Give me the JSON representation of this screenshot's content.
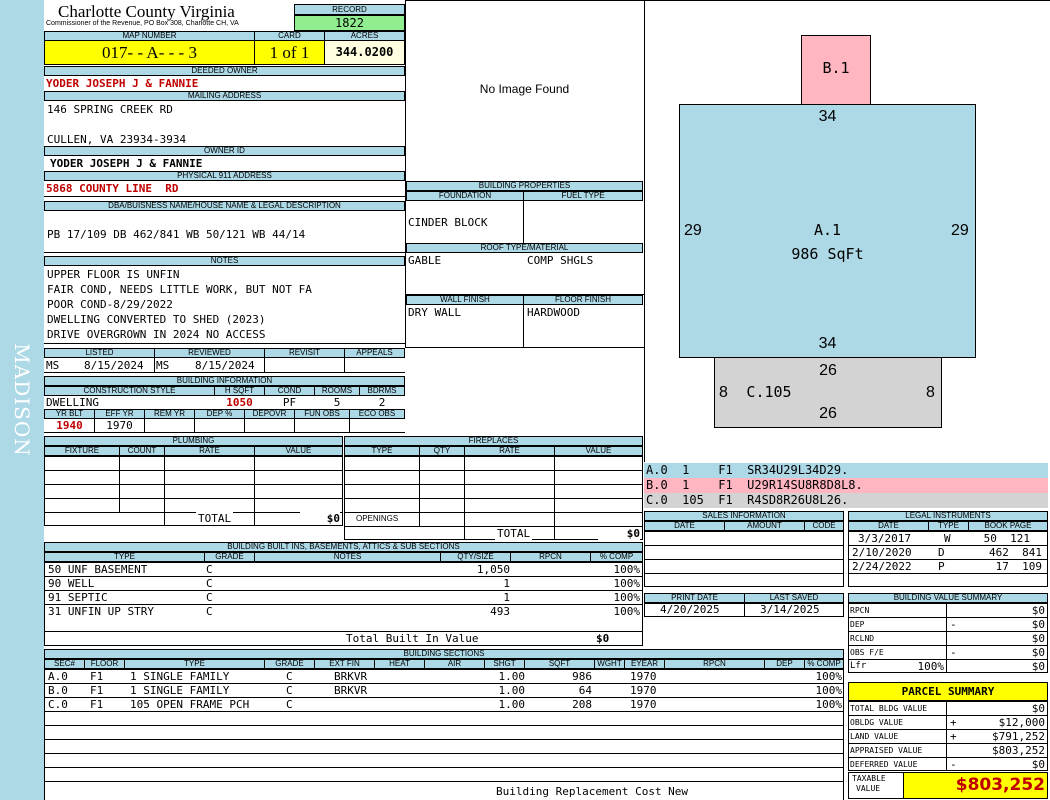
{
  "side_label": "MADISON",
  "header": {
    "title": "Charlotte County Virginia",
    "subtitle": "Commissioner of the Revenue, PO Box 308, Charlotte CH, VA",
    "record_label": "RECORD",
    "record": "1822",
    "map_label": "MAP NUMBER",
    "map": "017- - A- - - 3",
    "card_label": "CARD",
    "card": "1 of 1",
    "acres_label": "ACRES",
    "acres": "344.0200"
  },
  "owner": {
    "deeded_label": "DEEDED OWNER",
    "deeded": "YODER JOSEPH J & FANNIE",
    "mailing_label": "MAILING ADDRESS",
    "address1": "146 SPRING CREEK RD",
    "address2": "CULLEN, VA 23934-3934",
    "owner_id_label": "OWNER ID",
    "owner_id": "YODER JOSEPH J & FANNIE",
    "physical_label": "PHYSICAL 911 ADDRESS",
    "physical": "5868 COUNTY LINE  RD"
  },
  "dba": {
    "label": "DBA/BUISNESS NAME/HOUSE NAME & LEGAL DESCRIPTION",
    "text": "PB 17/109 DB 462/841 WB 50/121 WB 44/14"
  },
  "notes": {
    "label": "NOTES",
    "lines": [
      "UPPER FLOOR IS UNFIN",
      "FAIR COND, NEEDS LITTLE WORK, BUT NOT FA",
      "POOR COND-8/29/2022",
      "DWELLING CONVERTED TO SHED (2023)",
      "DRIVE OVERGROWN IN 2024 NO ACCESS"
    ]
  },
  "review": {
    "listed_label": "LISTED",
    "listed_by": "MS",
    "listed": "8/15/2024",
    "reviewed_label": "REVIEWED",
    "reviewed_by": "MS",
    "reviewed": "8/15/2024",
    "revisit_label": "REVISIT",
    "appeals_label": "APPEALS"
  },
  "building_info": {
    "label": "BUILDING INFORMATION",
    "style_label": "CONSTRUCTION STYLE",
    "style": "DWELLING",
    "hsqft_label": "H SQFT",
    "hsqft": "1050",
    "cond_label": "COND",
    "cond": "PF",
    "rooms_label": "ROOMS",
    "rooms": "5",
    "bdrms_label": "BDRMS",
    "bdrms": "2",
    "yrblt_label": "YR BLT",
    "yrblt": "1940",
    "effyr_label": "EFF YR",
    "effyr": "1970",
    "remyr_label": "REM YR",
    "dep_label": "DEP %",
    "depovr_label": "DEPOVR",
    "funobs_label": "FUN OBS",
    "ecoobs_label": "ECO OBS"
  },
  "image": {
    "text": "No Image Found"
  },
  "building_props": {
    "label": "BUILDING PROPERTIES",
    "foundation_label": "FOUNDATION",
    "foundation": "CINDER BLOCK",
    "fuel_label": "FUEL TYPE",
    "roof_label": "ROOF TYPE/MATERIAL",
    "roof_type": "GABLE",
    "roof_material": "COMP SHGLS",
    "wall_label": "WALL FINISH",
    "wall": "DRY WALL",
    "floor_label": "FLOOR FINISH",
    "floor": "HARDWOOD"
  },
  "sketch": {
    "b1": "B.1",
    "a1": "A.1",
    "a1_area": "986 SqFt",
    "c105": "C.105",
    "top34": "34",
    "bottom34": "34",
    "left29": "29",
    "right29": "29",
    "top26": "26",
    "bottom26": "26",
    "left8": "8",
    "right8": "8"
  },
  "sketch_codes": [
    {
      "text": "A.0  1    F1  SR34U29L34D29.",
      "color": "#add8e6"
    },
    {
      "text": "B.0  1    F1  U29R14SU8R8D8L8.",
      "color": "#ffb6c1"
    },
    {
      "text": "C.0  105  F1  R4SD8R26U8L26.",
      "color": "#d3d3d3"
    }
  ],
  "plumbing": {
    "label": "PLUMBING",
    "cols": [
      "FIXTURE",
      "COUNT",
      "RATE",
      "VALUE"
    ],
    "total_label": "TOTAL",
    "total": "$0"
  },
  "fireplaces": {
    "label": "FIREPLACES",
    "cols": [
      "TYPE",
      "QTY",
      "RATE",
      "VALUE"
    ],
    "openings_label": "OPENINGS",
    "total_label": "TOTAL",
    "total": "$0"
  },
  "sales": {
    "label": "SALES INFORMATION",
    "cols": [
      "DATE",
      "AMOUNT",
      "CODE"
    ]
  },
  "legal": {
    "label": "LEGAL INSTRUMENTS",
    "cols": [
      "DATE",
      "TYPE",
      "BOOK PAGE"
    ],
    "rows": [
      [
        "3/3/2017",
        "W",
        "50  121"
      ],
      [
        "2/10/2020",
        "D",
        "462  841"
      ],
      [
        "2/24/2022",
        "P",
        "17  109"
      ]
    ]
  },
  "dates": {
    "print_label": "PRINT DATE",
    "print": "4/20/2025",
    "saved_label": "LAST SAVED",
    "saved": "3/14/2025"
  },
  "builtins": {
    "label": "BUILDING BUILT INS, BASEMENTS, ATTICS & SUB SECTIONS",
    "cols": [
      "TYPE",
      "GRADE",
      "NOTES",
      "QTY/SIZE",
      "RPCN",
      "% COMP"
    ],
    "rows": [
      [
        "50 UNF BASEMENT",
        "C",
        "1,050",
        "100%"
      ],
      [
        "90 WELL",
        "C",
        "1",
        "100%"
      ],
      [
        "91 SEPTIC",
        "C",
        "1",
        "100%"
      ],
      [
        "31 UNFIN UP STRY",
        "C",
        "493",
        "100%"
      ]
    ],
    "total_label": "Total Built In Value",
    "total": "$0"
  },
  "summary": {
    "label": "BUILDING VALUE SUMMARY",
    "rows": [
      [
        "RPCN",
        "",
        "$0"
      ],
      [
        "DEP",
        "-",
        "$0"
      ],
      [
        "RCLND",
        "",
        "$0"
      ],
      [
        "OBS F/E",
        "-",
        "$0"
      ],
      [
        "Lfr",
        "100%",
        "$0"
      ]
    ]
  },
  "parcel": {
    "label": "PARCEL SUMMARY",
    "rows": [
      [
        "TOTAL BLDG VALUE",
        "",
        "$0"
      ],
      [
        "OBLDG VALUE",
        "+",
        "$12,000"
      ],
      [
        "LAND VALUE",
        "+",
        "$791,252"
      ],
      [
        "APPRAISED VALUE",
        "",
        "$803,252"
      ],
      [
        "DEFERRED VALUE",
        "-",
        "$0"
      ]
    ],
    "taxable_label1": "TAXABLE",
    "taxable_label2": "VALUE",
    "taxable": "$803,252"
  },
  "sections": {
    "label": "BUILDING SECTIONS",
    "cols": [
      "SEC#",
      "FLOOR",
      "TYPE",
      "GRADE",
      "EXT FIN",
      "HEAT",
      "AIR",
      "SHGT",
      "SQFT",
      "WGHT",
      "EYEAR",
      "RPCN",
      "DEP",
      "% COMP"
    ],
    "rows": [
      [
        "A.0",
        "F1",
        "1 SINGLE FAMILY",
        "C",
        "BRKVR",
        "1.00",
        "986",
        "1970",
        "100%"
      ],
      [
        "B.0",
        "F1",
        "1 SINGLE FAMILY",
        "C",
        "BRKVR",
        "1.00",
        "64",
        "1970",
        "100%"
      ],
      [
        "C.0",
        "F1",
        "105 OPEN FRAME PCH",
        "C",
        "",
        "1.00",
        "208",
        "1970",
        "100%"
      ]
    ],
    "footer": "Building Replacement Cost New"
  }
}
